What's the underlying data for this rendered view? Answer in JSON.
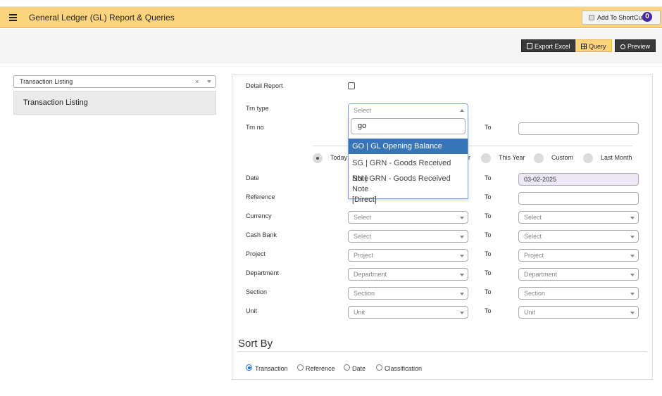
{
  "header": {
    "title": "General Ledger (GL) Report & Queries",
    "shortcut_label": "Add To ShortCut",
    "shortcut_count": "0",
    "accent_color": "#fdd47e"
  },
  "toolbar": {
    "export_label": "Export Excel",
    "query_label": "Query",
    "preview_label": "Preview"
  },
  "sidebar": {
    "report_select_value": "Transaction Listing",
    "clear_glyph": "×",
    "active_item": "Transaction Listing"
  },
  "form": {
    "detail_report_label": "Detail Report",
    "trn_type_label": "Trn type",
    "trn_type_placeholder": "Select",
    "trn_no_label": "Trn no",
    "to_label": "To",
    "date_label": "Date",
    "date_to_value": "03-02-2025",
    "reference_label": "Reference",
    "currency_label": "Currency",
    "cash_bank_label": "Cash Bank",
    "project_label": "Project",
    "department_label": "Department",
    "section_label": "Section",
    "unit_label": "Unit",
    "select_placeholder": "Select",
    "project_placeholder": "Project",
    "department_placeholder": "Department",
    "section_placeholder": "Section",
    "unit_placeholder": "Unit"
  },
  "period": {
    "today": "Today",
    "partial_label": "r",
    "this_year": "This Year",
    "custom": "Custom",
    "last_month": "Last Month",
    "selected": "Today"
  },
  "dropdown": {
    "search_value": "go",
    "options": [
      "GO | GL Opening Balance",
      "SG | GRN - Goods Received Note",
      "SN | GRN - Goods Received Note",
      "[Direct]"
    ],
    "highlighted": "GO | GL Opening Balance"
  },
  "sort": {
    "title": "Sort By",
    "options": [
      "Transaction",
      "Reference",
      "Date",
      "Classification"
    ],
    "selected": "Transaction"
  }
}
